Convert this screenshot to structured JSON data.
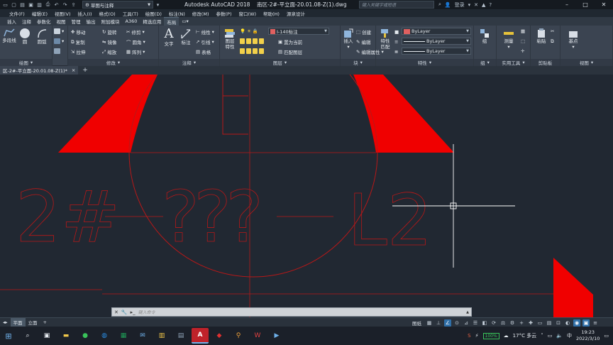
{
  "title_bar": {
    "workspace": "草图与注释",
    "app_title": "Autodesk AutoCAD 2018",
    "file_name": "南区-2#-平立面-20.01.08-Z(1).dwg",
    "search_placeholder": "键入关键字或短语",
    "login": "登录"
  },
  "menu": [
    "文件(F)",
    "编辑(E)",
    "视图(V)",
    "插入(I)",
    "格式(O)",
    "工具(T)",
    "绘图(D)",
    "标注(N)",
    "修改(M)",
    "参数(P)",
    "窗口(W)",
    "帮助(H)",
    "源泉设计"
  ],
  "ribbon_tabs": [
    {
      "label": "插入",
      "active": false
    },
    {
      "label": "注释",
      "active": false
    },
    {
      "label": "参数化",
      "active": false
    },
    {
      "label": "视图",
      "active": false
    },
    {
      "label": "管理",
      "active": false
    },
    {
      "label": "输出",
      "active": false
    },
    {
      "label": "附加模块",
      "active": false
    },
    {
      "label": "A360",
      "active": false
    },
    {
      "label": "精选应用",
      "active": false
    },
    {
      "label": "布局",
      "active": true
    }
  ],
  "ribbon": {
    "draw": {
      "title": "绘图",
      "polyline": "多段线",
      "circle": "圆",
      "arc": "圆弧"
    },
    "modify": {
      "title": "修改",
      "move": "移动",
      "rotate": "旋转",
      "trim": "修剪",
      "copy": "复制",
      "mirror": "镜像",
      "fillet": "圆角",
      "stretch": "拉伸",
      "scale": "缩放",
      "array": "阵列"
    },
    "annotation": {
      "title": "注释",
      "text": "文字",
      "dimension": "标注",
      "linear": "线性",
      "leader": "引线",
      "table": "表格"
    },
    "layers": {
      "title": "图层",
      "properties_line1": "图层",
      "properties_line2": "特性",
      "current_layer": "I-140标注",
      "set_current": "置为当前",
      "match_layer": "匹配图层"
    },
    "block": {
      "title": "块",
      "insert": "插入",
      "create": "创建",
      "edit": "编辑",
      "edit_attributes": "编辑属性"
    },
    "properties": {
      "title": "特性",
      "match_line1": "特性",
      "match_line2": "匹配",
      "color": "ByLayer",
      "linetype": "ByLayer",
      "lineweight": "ByLayer",
      "color_swatch": "#e06060"
    },
    "groups": {
      "title": "组",
      "group": "组"
    },
    "utilities": {
      "title": "实用工具",
      "measure": "测量"
    },
    "clipboard": {
      "title": "剪贴板",
      "paste": "粘贴"
    },
    "view": {
      "title": "视图",
      "base": "基点"
    }
  },
  "document_tab": {
    "label": "区-2#-平立面-20.01.08-Z(1)*",
    "close": "×",
    "add": "+"
  },
  "drawing": {
    "text_left": "2#",
    "text_mid": "???",
    "text_right": "L2",
    "accent_red": "#f00000"
  },
  "command_line": {
    "placeholder": "键入命令"
  },
  "layout_tabs": [
    {
      "label": "平面",
      "active": true
    },
    {
      "label": "立面",
      "active": false
    }
  ],
  "status_bar": {
    "model_label": "图纸"
  },
  "taskbar": {
    "battery": "100%",
    "weather": "17°C 多云",
    "time": "19:23",
    "date": "2022/3/10"
  }
}
